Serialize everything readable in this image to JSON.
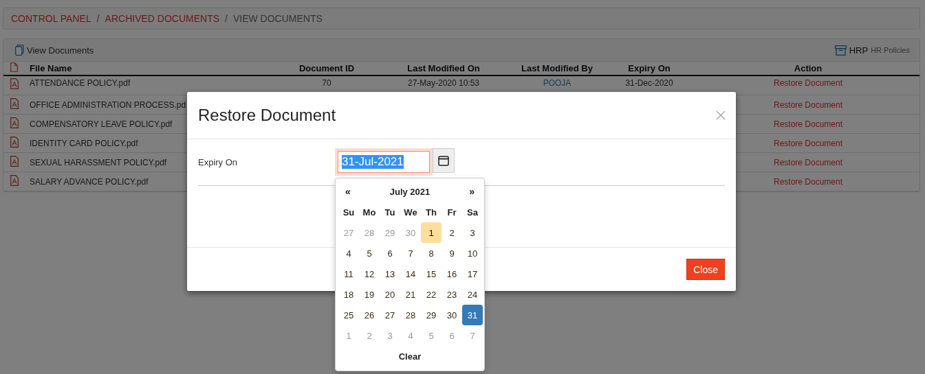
{
  "breadcrumb": {
    "separator": "/",
    "items": [
      {
        "label": "CONTROL PANEL",
        "kind": "link"
      },
      {
        "label": "ARCHIVED DOCUMENTS",
        "kind": "link"
      },
      {
        "label": "VIEW DOCUMENTS",
        "kind": "current"
      }
    ]
  },
  "panel": {
    "title": "View Documents",
    "badge": "HRP",
    "badge_caption": "HR Policies"
  },
  "table": {
    "columns": [
      "File Name",
      "Document ID",
      "Last Modified On",
      "Last Modified By",
      "Expiry On",
      "Action"
    ],
    "rows": [
      {
        "file": "ATTENDANCE POLICY.pdf",
        "id": "70",
        "modified_on": "27-May-2020 10:53",
        "modified_by": "POOJA",
        "expiry": "31-Dec-2020",
        "action": "Restore Document"
      },
      {
        "file": "OFFICE ADMINISTRATION PROCESS.pd",
        "action": "Restore Document"
      },
      {
        "file": "COMPENSATORY LEAVE POLICY.pdf",
        "action": "Restore Document"
      },
      {
        "file": "IDENTITY CARD POLICY.pdf",
        "action": "Restore Document"
      },
      {
        "file": "SEXUAL HARASSMENT POLICY.pdf",
        "action": "Restore Document"
      },
      {
        "file": "SALARY ADVANCE POLICY.pdf",
        "action": "Restore Document"
      }
    ]
  },
  "modal": {
    "title": "Restore Document",
    "field_label": "Expiry On",
    "value": "31-Jul-2021",
    "close_button": "Close"
  },
  "datepicker": {
    "prev": "«",
    "title": "July 2021",
    "next": "»",
    "weekdays": [
      "Su",
      "Mo",
      "Tu",
      "We",
      "Th",
      "Fr",
      "Sa"
    ],
    "weeks": [
      [
        {
          "day": "27",
          "muted": true,
          "today": false,
          "selected": false
        },
        {
          "day": "28",
          "muted": true,
          "today": false,
          "selected": false
        },
        {
          "day": "29",
          "muted": true,
          "today": false,
          "selected": false
        },
        {
          "day": "30",
          "muted": true,
          "today": false,
          "selected": false
        },
        {
          "day": "1",
          "muted": false,
          "today": true,
          "selected": false
        },
        {
          "day": "2",
          "muted": false,
          "today": false,
          "selected": false
        },
        {
          "day": "3",
          "muted": false,
          "today": false,
          "selected": false
        }
      ],
      [
        {
          "day": "4",
          "muted": false,
          "today": false,
          "selected": false
        },
        {
          "day": "5",
          "muted": false,
          "today": false,
          "selected": false
        },
        {
          "day": "6",
          "muted": false,
          "today": false,
          "selected": false
        },
        {
          "day": "7",
          "muted": false,
          "today": false,
          "selected": false
        },
        {
          "day": "8",
          "muted": false,
          "today": false,
          "selected": false
        },
        {
          "day": "9",
          "muted": false,
          "today": false,
          "selected": false
        },
        {
          "day": "10",
          "muted": false,
          "today": false,
          "selected": false
        }
      ],
      [
        {
          "day": "11",
          "muted": false,
          "today": false,
          "selected": false
        },
        {
          "day": "12",
          "muted": false,
          "today": false,
          "selected": false
        },
        {
          "day": "13",
          "muted": false,
          "today": false,
          "selected": false
        },
        {
          "day": "14",
          "muted": false,
          "today": false,
          "selected": false
        },
        {
          "day": "15",
          "muted": false,
          "today": false,
          "selected": false
        },
        {
          "day": "16",
          "muted": false,
          "today": false,
          "selected": false
        },
        {
          "day": "17",
          "muted": false,
          "today": false,
          "selected": false
        }
      ],
      [
        {
          "day": "18",
          "muted": false,
          "today": false,
          "selected": false
        },
        {
          "day": "19",
          "muted": false,
          "today": false,
          "selected": false
        },
        {
          "day": "20",
          "muted": false,
          "today": false,
          "selected": false
        },
        {
          "day": "21",
          "muted": false,
          "today": false,
          "selected": false
        },
        {
          "day": "22",
          "muted": false,
          "today": false,
          "selected": false
        },
        {
          "day": "23",
          "muted": false,
          "today": false,
          "selected": false
        },
        {
          "day": "24",
          "muted": false,
          "today": false,
          "selected": false
        }
      ],
      [
        {
          "day": "25",
          "muted": false,
          "today": false,
          "selected": false
        },
        {
          "day": "26",
          "muted": false,
          "today": false,
          "selected": false
        },
        {
          "day": "27",
          "muted": false,
          "today": false,
          "selected": false
        },
        {
          "day": "28",
          "muted": false,
          "today": false,
          "selected": false
        },
        {
          "day": "29",
          "muted": false,
          "today": false,
          "selected": false
        },
        {
          "day": "30",
          "muted": false,
          "today": false,
          "selected": false
        },
        {
          "day": "31",
          "muted": false,
          "today": false,
          "selected": true
        }
      ],
      [
        {
          "day": "1",
          "muted": true,
          "today": false,
          "selected": false
        },
        {
          "day": "2",
          "muted": true,
          "today": false,
          "selected": false
        },
        {
          "day": "3",
          "muted": true,
          "today": false,
          "selected": false
        },
        {
          "day": "4",
          "muted": true,
          "today": false,
          "selected": false
        },
        {
          "day": "5",
          "muted": true,
          "today": false,
          "selected": false
        },
        {
          "day": "6",
          "muted": true,
          "today": false,
          "selected": false
        },
        {
          "day": "7",
          "muted": true,
          "today": false,
          "selected": false
        }
      ]
    ],
    "clear": "Clear"
  }
}
